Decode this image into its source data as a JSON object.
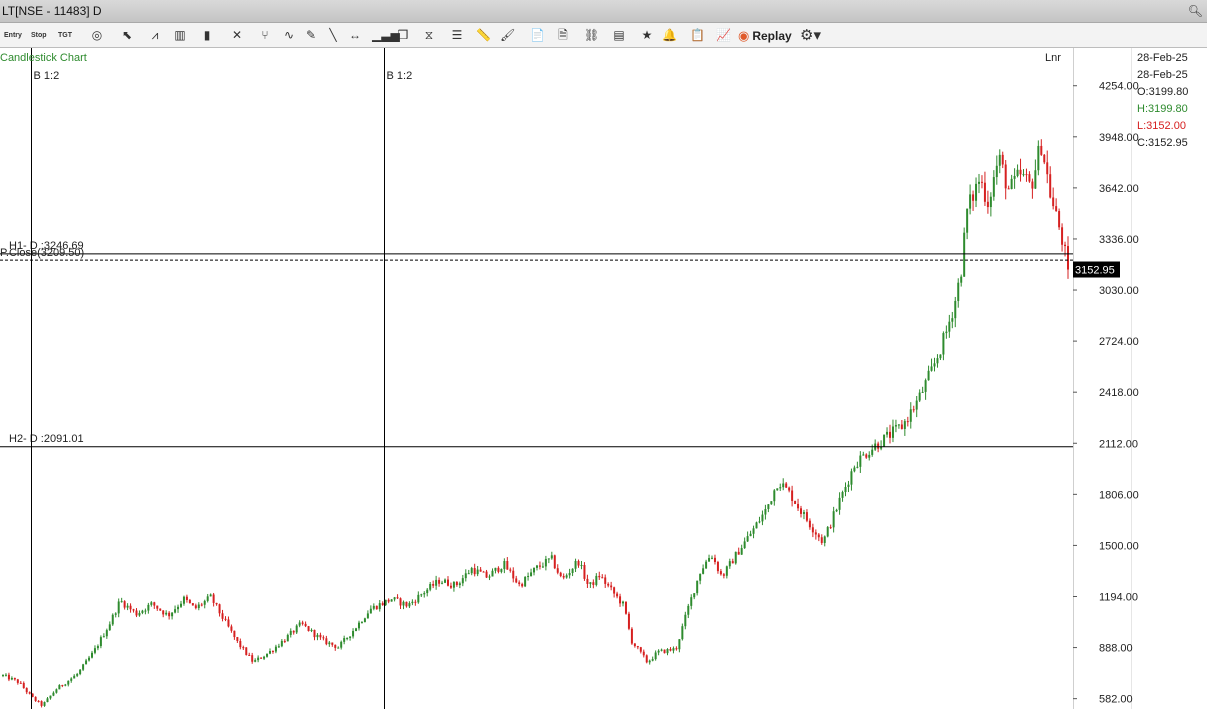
{
  "window": {
    "title": "LT[NSE - 11483] D"
  },
  "toolbar": {
    "items": [
      {
        "name": "entry-button",
        "label": "Entry",
        "icon": "entry-icon"
      },
      {
        "name": "stop-button",
        "label": "Stop",
        "icon": "stop-icon"
      },
      {
        "name": "target-button",
        "label": "TGT",
        "icon": "target-icon"
      },
      {
        "name": "crosshair-button",
        "label": "◎",
        "icon": "crosshair-icon"
      },
      {
        "name": "cursor-button",
        "label": "⬉",
        "icon": "cursor-icon"
      },
      {
        "name": "chart-style-button",
        "label": "⩘",
        "icon": "chart-style-icon"
      },
      {
        "name": "bar-chart-button",
        "label": "▥",
        "icon": "bar-chart-icon"
      },
      {
        "name": "candle-button",
        "label": "▮",
        "icon": "candle-icon"
      },
      {
        "name": "indicator-button",
        "label": "✕",
        "icon": "indicator-icon"
      },
      {
        "name": "fork-button",
        "label": "⑂",
        "icon": "fork-icon"
      },
      {
        "name": "wave-button",
        "label": "∿",
        "icon": "wave-icon"
      },
      {
        "name": "pencil-button",
        "label": "✎",
        "icon": "pencil-icon"
      },
      {
        "name": "trendline-button",
        "label": "╲",
        "icon": "trendline-icon"
      },
      {
        "name": "hline-button",
        "label": "↔",
        "icon": "hline-icon"
      },
      {
        "name": "volume-button",
        "label": "▁▃▅",
        "icon": "volume-icon"
      },
      {
        "name": "cube-button",
        "label": "❒",
        "icon": "cube-icon"
      },
      {
        "name": "fib-button",
        "label": "⧖",
        "icon": "fib-icon"
      },
      {
        "name": "lines-button",
        "label": "☰",
        "icon": "lines-icon"
      },
      {
        "name": "ruler-button",
        "label": "📏",
        "icon": "ruler-icon"
      },
      {
        "name": "paint-button",
        "label": "🖌",
        "icon": "paint-icon"
      },
      {
        "name": "report-button",
        "label": "📄",
        "icon": "report-icon"
      },
      {
        "name": "settings-doc-button",
        "label": "🗎",
        "icon": "settings-doc-icon"
      },
      {
        "name": "link-button",
        "label": "⛓",
        "icon": "link-icon"
      },
      {
        "name": "layout-button",
        "label": "▤",
        "icon": "layout-icon"
      },
      {
        "name": "favorite-button",
        "label": "★",
        "icon": "star-icon"
      },
      {
        "name": "alert-button",
        "label": "🔔",
        "icon": "bell-icon"
      },
      {
        "name": "clipboard-button",
        "label": "📋",
        "icon": "clipboard-icon"
      },
      {
        "name": "line-chart-button",
        "label": "📈",
        "icon": "line-chart-icon"
      }
    ],
    "replay_label": "Replay",
    "settings_icon": "gear-icon"
  },
  "chart_labels": {
    "type_label": "Candlestick Chart",
    "scale_label": "Lnr",
    "marker1": "B 1:2",
    "marker2": "B 1:2",
    "h1": "H1- D :3246.69",
    "pclose": "P.Close(3209.50)",
    "h2": "H2- D :2091.01",
    "last_price": "3152.95"
  },
  "info_panel": {
    "date1": "28-Feb-25",
    "date2": "28-Feb-25",
    "open": "O:3199.80",
    "high": "H:3199.80",
    "low": "L:3152.00",
    "close": "C:3152.95"
  },
  "colors": {
    "up": "#2e8b2e",
    "down": "#d62020",
    "high_text": "#2e8b2e",
    "low_text": "#d62020",
    "type_label": "#2e8b2e",
    "price_tag_bg": "#000000"
  },
  "chart_data": {
    "type": "candlestick",
    "title": "Candlestick Chart",
    "symbol": "LT",
    "exchange": "NSE",
    "timeframe": "D",
    "y_scale": "linear",
    "ylim": [
      520,
      4480
    ],
    "yticks": [
      582,
      888,
      1194,
      1500,
      1806,
      2112,
      2418,
      2724,
      3030,
      3336,
      3642,
      3948,
      4254
    ],
    "ytick_labels": [
      "582.00",
      "888.00",
      "1194.00",
      "1500.00",
      "1806.00",
      "2112.00",
      "2418.00",
      "2724.00",
      "3030.00",
      "3336.00",
      "3642.00",
      "3948.00",
      "4254.00"
    ],
    "horizontal_levels": [
      {
        "label": "H1- D :3246.69",
        "value": 3246.69,
        "style": "solid"
      },
      {
        "label": "P.Close(3209.50)",
        "value": 3209.5,
        "style": "dashed"
      },
      {
        "label": "H2- D :2091.01",
        "value": 2091.01,
        "style": "solid"
      }
    ],
    "vertical_markers": [
      {
        "label": "B 1:2",
        "bar_fraction": 0.026
      },
      {
        "label": "B 1:2",
        "bar_fraction": 0.358
      }
    ],
    "last_price": 3152.95,
    "last_bar": {
      "date": "28-Feb-25",
      "open": 3199.8,
      "high": 3199.8,
      "low": 3152.0,
      "close": 3152.95
    },
    "price_path": [
      [
        0.0,
        720
      ],
      [
        0.015,
        680
      ],
      [
        0.027,
        590
      ],
      [
        0.037,
        540
      ],
      [
        0.05,
        640
      ],
      [
        0.07,
        730
      ],
      [
        0.085,
        860
      ],
      [
        0.1,
        1030
      ],
      [
        0.11,
        1170
      ],
      [
        0.125,
        1090
      ],
      [
        0.14,
        1150
      ],
      [
        0.155,
        1080
      ],
      [
        0.17,
        1180
      ],
      [
        0.18,
        1120
      ],
      [
        0.195,
        1190
      ],
      [
        0.205,
        1080
      ],
      [
        0.22,
        920
      ],
      [
        0.235,
        800
      ],
      [
        0.25,
        860
      ],
      [
        0.265,
        940
      ],
      [
        0.28,
        1030
      ],
      [
        0.3,
        930
      ],
      [
        0.315,
        890
      ],
      [
        0.33,
        1000
      ],
      [
        0.345,
        1120
      ],
      [
        0.365,
        1180
      ],
      [
        0.38,
        1140
      ],
      [
        0.395,
        1220
      ],
      [
        0.41,
        1290
      ],
      [
        0.425,
        1260
      ],
      [
        0.44,
        1360
      ],
      [
        0.455,
        1310
      ],
      [
        0.47,
        1390
      ],
      [
        0.485,
        1260
      ],
      [
        0.5,
        1360
      ],
      [
        0.515,
        1420
      ],
      [
        0.525,
        1290
      ],
      [
        0.54,
        1410
      ],
      [
        0.55,
        1250
      ],
      [
        0.56,
        1320
      ],
      [
        0.57,
        1240
      ],
      [
        0.583,
        1140
      ],
      [
        0.59,
        930
      ],
      [
        0.605,
        800
      ],
      [
        0.615,
        860
      ],
      [
        0.632,
        880
      ],
      [
        0.643,
        1120
      ],
      [
        0.655,
        1350
      ],
      [
        0.665,
        1450
      ],
      [
        0.675,
        1310
      ],
      [
        0.69,
        1460
      ],
      [
        0.705,
        1600
      ],
      [
        0.717,
        1720
      ],
      [
        0.728,
        1890
      ],
      [
        0.74,
        1800
      ],
      [
        0.752,
        1680
      ],
      [
        0.762,
        1590
      ],
      [
        0.77,
        1520
      ],
      [
        0.785,
        1760
      ],
      [
        0.8,
        1990
      ],
      [
        0.815,
        2080
      ],
      [
        0.83,
        2150
      ],
      [
        0.845,
        2220
      ],
      [
        0.86,
        2380
      ],
      [
        0.873,
        2560
      ],
      [
        0.885,
        2760
      ],
      [
        0.895,
        2990
      ],
      [
        0.9,
        3170
      ],
      [
        0.905,
        3500
      ],
      [
        0.917,
        3700
      ],
      [
        0.925,
        3560
      ],
      [
        0.935,
        3820
      ],
      [
        0.945,
        3620
      ],
      [
        0.955,
        3720
      ],
      [
        0.965,
        3650
      ],
      [
        0.975,
        3910
      ],
      [
        0.985,
        3550
      ],
      [
        0.993,
        3380
      ],
      [
        1.0,
        3152.95
      ]
    ]
  }
}
